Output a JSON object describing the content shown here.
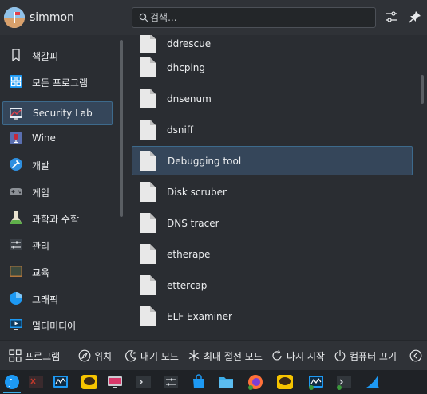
{
  "header": {
    "username": "simmon",
    "search_placeholder": "검색...",
    "icons": {
      "configure": "sliders-icon",
      "pin": "pin-icon",
      "search": "search-icon"
    }
  },
  "nav": {
    "items": [
      {
        "label": "책갈피",
        "icon": "bookmark-icon"
      },
      {
        "label": "모든 프로그램",
        "icon": "grid-icon"
      },
      {
        "label": "Security Lab",
        "icon": "security-lab-icon",
        "active": true
      },
      {
        "label": "Wine",
        "icon": "wine-icon"
      },
      {
        "label": "개발",
        "icon": "development-icon"
      },
      {
        "label": "게임",
        "icon": "gamepad-icon"
      },
      {
        "label": "과학과 수학",
        "icon": "flask-icon"
      },
      {
        "label": "관리",
        "icon": "settings-sliders-icon"
      },
      {
        "label": "교육",
        "icon": "education-icon"
      },
      {
        "label": "그래픽",
        "icon": "graphics-icon"
      },
      {
        "label": "멀티미디어",
        "icon": "multimedia-icon"
      }
    ]
  },
  "apps": {
    "items": [
      {
        "label": "ddrescue",
        "partial": true
      },
      {
        "label": "dhcping"
      },
      {
        "label": "dnsenum"
      },
      {
        "label": "dsniff"
      },
      {
        "label": "Debugging tool",
        "selected": true
      },
      {
        "label": "Disk scruber"
      },
      {
        "label": "DNS tracer"
      },
      {
        "label": "etherape"
      },
      {
        "label": "ettercap"
      },
      {
        "label": "ELF Examiner"
      }
    ]
  },
  "footer": {
    "programs": "프로그램",
    "location": "위치",
    "sleep": "대기 모드",
    "hibernate": "최대 절전 모드",
    "restart": "다시 시작",
    "shutdown": "컴퓨터 끄기"
  },
  "taskbar": {
    "items": [
      "kde-launcher-icon",
      "terminal-red-icon",
      "system-monitor-icon",
      "chat-bubble-icon",
      "display-icon",
      "terminal-icon",
      "sliders-app-icon",
      "store-icon",
      "folder-icon",
      "firefox-icon",
      "chat-bubble-icon-2",
      "system-monitor-icon-2",
      "terminal-icon-2",
      "wireshark-icon"
    ]
  },
  "colors": {
    "accent": "#3daee9",
    "selection_bg": "#35465a",
    "selection_border": "#3d6a8c",
    "bg": "#2a2d32"
  }
}
